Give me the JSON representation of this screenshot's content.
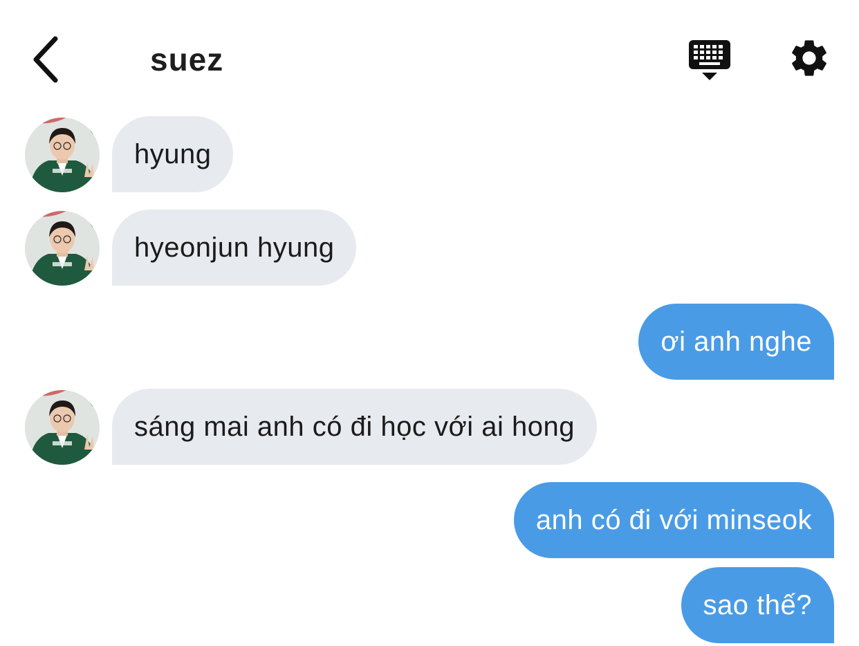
{
  "header": {
    "title": "suez",
    "back_icon": "chevron-left-icon",
    "keyboard_icon": "keyboard-hide-icon",
    "settings_icon": "gear-icon"
  },
  "colors": {
    "incoming_bubble": "#e7eaee",
    "outgoing_bubble": "#4a9be6",
    "outgoing_text": "#ffffff",
    "incoming_text": "#1b1b1b",
    "background": "#ffffff"
  },
  "messages": [
    {
      "direction": "incoming",
      "text": "hyung"
    },
    {
      "direction": "incoming",
      "text": "hyeonjun hyung"
    },
    {
      "direction": "outgoing",
      "text": "ơi anh nghe"
    },
    {
      "direction": "incoming",
      "text": "sáng mai anh có đi học với ai hong"
    },
    {
      "direction": "outgoing",
      "text": "anh có đi với minseok"
    },
    {
      "direction": "outgoing",
      "text": "sao thế?"
    }
  ]
}
